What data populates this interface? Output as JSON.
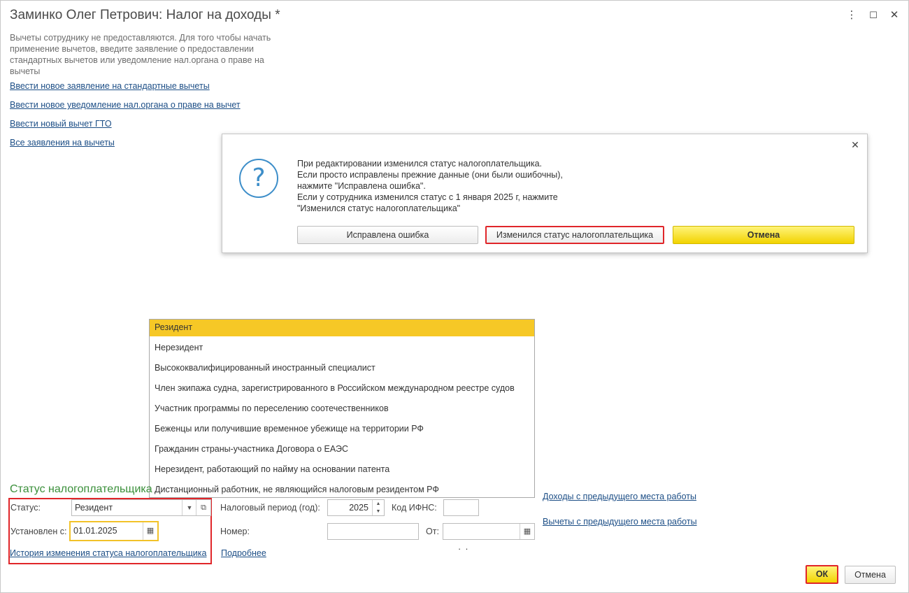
{
  "window": {
    "title": "Заминко Олег Петрович: Налог на доходы *",
    "controls": {
      "more": "⋮",
      "maximize": "☐",
      "close": "✕"
    }
  },
  "info_text": "Вычеты сотруднику не предоставляются. Для того чтобы начать применение вычетов, введите заявление о предоставлении стандартных вычетов или уведомление нал.органа о праве на вычеты",
  "links": {
    "new_application": "Ввести новое заявление на стандартные вычеты",
    "new_notice": "Ввести новое уведомление нал.органа о праве на вычет",
    "new_gto": "Ввести новый вычет ГТО",
    "all_applications": "Все заявления на вычеты",
    "income_prev": "Доходы с предыдущего места работы",
    "deductions_prev": "Вычеты с предыдущего места работы",
    "status_history": "История изменения статуса налогоплательщика",
    "more": "Подробнее"
  },
  "modal": {
    "text": "При редактировании изменился статус налогоплательщика.\nЕсли просто исправлены прежние данные (они были ошибочны),\nнажмите \"Исправлена ошибка\".\nЕсли у сотрудника изменился статус с 1 января 2025 г, нажмите\n\"Изменился статус налогоплательщика\"",
    "btn_error_fixed": "Исправлена ошибка",
    "btn_status_changed": "Изменился статус налогоплательщика",
    "btn_cancel": "Отмена",
    "close": "✕",
    "icon": "?"
  },
  "dropdown_options": [
    "Резидент",
    "Нерезидент",
    "Высококвалифицированный иностранный специалист",
    "Член экипажа судна, зарегистрированного в Российском международном реестре судов",
    "Участник программы по переселению соотечественников",
    "Беженцы или получившие временное убежище на территории РФ",
    "Гражданин страны-участника Договора о ЕАЭС",
    "Нерезидент, работающий по найму на основании патента",
    "Дистанционный работник, не являющийся налоговым резидентом РФ"
  ],
  "form": {
    "section_title": "Статус налогоплательщика",
    "status_label": "Статус:",
    "status_value": "Резидент",
    "established_label": "Установлен с:",
    "established_value": "01.01.2025",
    "tax_period_label": "Налоговый период (год):",
    "tax_period_value": "2025",
    "ifns_label": "Код ИФНС:",
    "ifns_value": "",
    "number_label": "Номер:",
    "number_value": "",
    "from_label": "От:",
    "from_value": " .  ."
  },
  "buttons": {
    "ok": "ОК",
    "cancel": "Отмена"
  }
}
